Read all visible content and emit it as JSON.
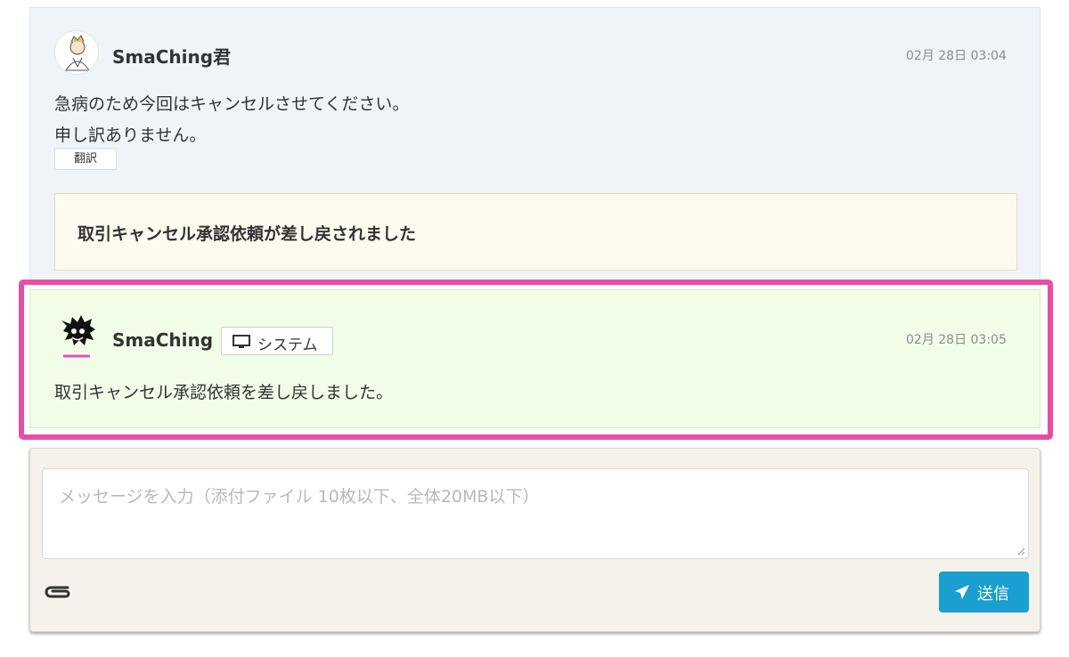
{
  "messages": [
    {
      "sender": "SmaChing君",
      "time": "02月 28日 03:04",
      "lines": [
        "急病のため今回はキャンセルさせてください。",
        "申し訳ありません。"
      ],
      "translate_label": "翻訳",
      "notice": "取引キャンセル承認依頼が差し戻されました"
    },
    {
      "sender": "SmaChing",
      "tag": "システム",
      "time": "02月 28日 03:05",
      "text": "取引キャンセル承認依頼を差し戻しました。"
    }
  ],
  "composer": {
    "placeholder": "メッセージを入力（添付ファイル 10枚以下、全体20MB以下）",
    "send_label": "送信"
  },
  "colors": {
    "highlight": "#e64fa6",
    "send_button": "#1a9fd0",
    "system_message_bg": "#f2fde8",
    "user_message_bg": "#eef4f8"
  }
}
